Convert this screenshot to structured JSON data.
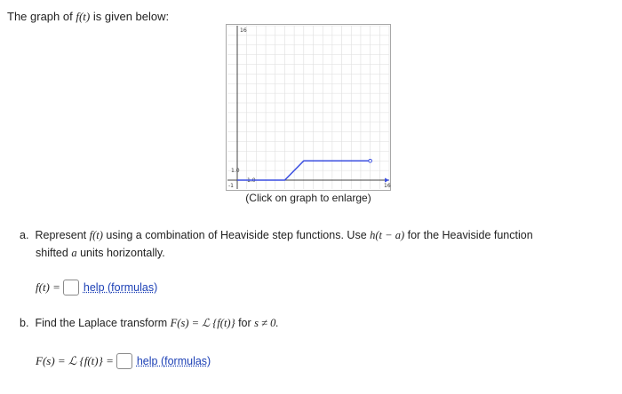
{
  "header": {
    "prefix": "The graph of",
    "func": "f(t)",
    "suffix": "is given below:"
  },
  "graph": {
    "caption": "(Click on graph to enlarge)",
    "labels": {
      "y_top": "16",
      "y_one": "1.0",
      "x_left": "-1",
      "x_mark": "1.0",
      "x_right": "16"
    },
    "line_color": "#3b4fe0",
    "chart_data": {
      "type": "line",
      "xlim": [
        -1,
        16
      ],
      "ylim": [
        -0.2,
        16
      ],
      "series": [
        {
          "points": [
            [
              0,
              0
            ],
            [
              5,
              0
            ],
            [
              7,
              2
            ],
            [
              14,
              2
            ]
          ]
        }
      ],
      "endpoint": [
        14,
        2
      ],
      "grid": true
    }
  },
  "part_a": {
    "label": "a.",
    "line1_pre": "Represent",
    "func": "f(t)",
    "line1_mid": "using a combination of Heaviside step functions. Use",
    "heaviside": "h(t − a)",
    "line1_post": "for the Heaviside function",
    "line2_pre": "shifted",
    "var_a": "a",
    "line2_post": "units horizontally.",
    "answer_lhs": "f(t) =",
    "help": "help (formulas)"
  },
  "part_b": {
    "label": "b.",
    "text_pre": "Find the Laplace transform",
    "transform": "F(s) = ℒ {f(t)}",
    "text_mid": "for",
    "cond": "s ≠ 0.",
    "answer_lhs": "F(s) = ℒ {f(t)} =",
    "help": "help (formulas)"
  }
}
